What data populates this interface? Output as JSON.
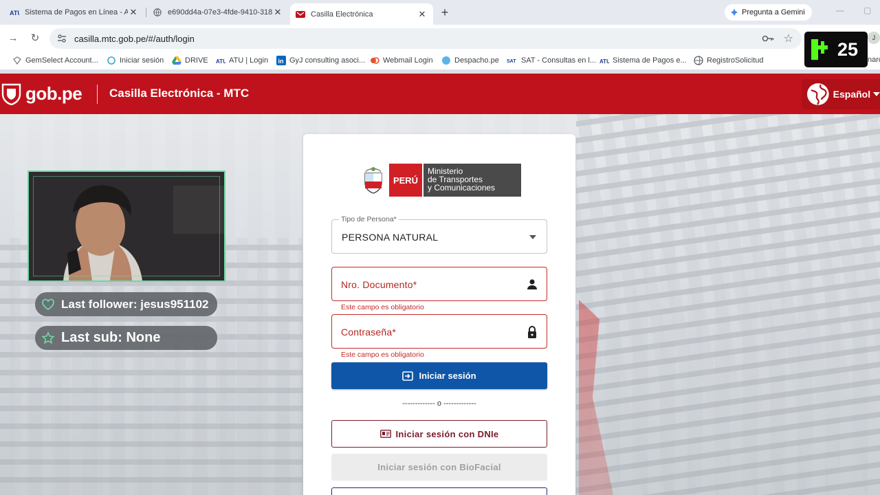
{
  "browser": {
    "tabs": [
      {
        "title": "Sistema de Pagos en Línea - AT",
        "active": false
      },
      {
        "title": "e690dd4a-07e3-4fde-9410-318",
        "active": false
      },
      {
        "title": "Casilla Electrónica",
        "active": true
      }
    ],
    "new_tab": "+",
    "gemini_label": "Pregunta a Gemini",
    "url": "casilla.mtc.gob.pe/#/auth/login",
    "profile_initial": "J",
    "bookmarks": [
      {
        "label": "GemSelect Account..."
      },
      {
        "label": "Iniciar sesión"
      },
      {
        "label": "DRIVE"
      },
      {
        "label": "ATU | Login"
      },
      {
        "label": "GyJ consulting asoci..."
      },
      {
        "label": "Webmail Login"
      },
      {
        "label": "Despacho.pe"
      },
      {
        "label": "SAT - Consultas en l..."
      },
      {
        "label": "Sistema de Pagos e..."
      },
      {
        "label": "RegistroSolicitud"
      },
      {
        "label": "narc"
      }
    ]
  },
  "header": {
    "logo_text": "gob.pe",
    "title": "Casilla Electrónica - MTC",
    "language": "Español"
  },
  "overlay": {
    "last_follower": "Last follower: jesus951102",
    "last_sub": "Last sub: None",
    "badge_number": "25"
  },
  "login": {
    "logo": {
      "peru": "PERÚ",
      "ministry_line1": "Ministerio",
      "ministry_line2": "de Transportes",
      "ministry_line3": "y Comunicaciones"
    },
    "tipo_persona": {
      "label": "Tipo de Persona*",
      "value": "PERSONA NATURAL"
    },
    "documento": {
      "placeholder": "Nro. Documento*",
      "error": "Este campo es obligatorio"
    },
    "password": {
      "placeholder": "Contraseña*",
      "error": "Este campo es obligatorio"
    },
    "submit_label": "Iniciar sesión",
    "separator": "------------- o -------------",
    "dnie_label": "Iniciar sesión con DNIe",
    "biofacial_label": "Iniciar sesión con BioFacial"
  },
  "colors": {
    "header_red": "#c0121c",
    "primary_blue": "#0f56a8",
    "error_red": "#c62828",
    "overlay_green": "#6fd8a4"
  }
}
